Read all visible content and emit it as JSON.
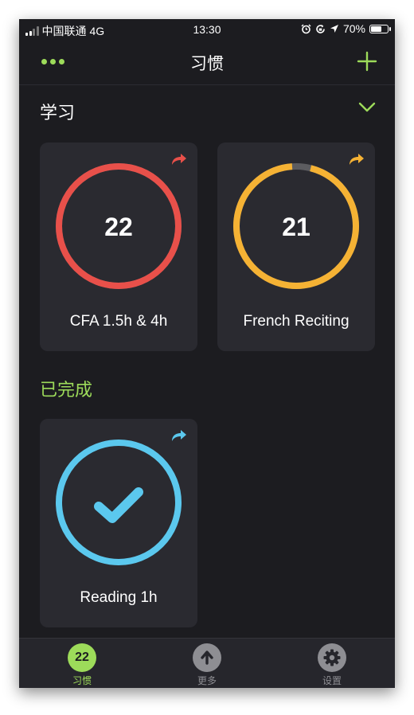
{
  "status_bar": {
    "carrier": "中国联通",
    "network": "4G",
    "time": "13:30",
    "battery": "70%",
    "battery_level": 0.7
  },
  "nav": {
    "title": "习惯",
    "more_icon": "ellipsis-icon",
    "add_icon": "plus-icon"
  },
  "sections": {
    "learning_title": "学习",
    "completed_title": "已完成"
  },
  "habits": [
    {
      "count": "22",
      "label": "CFA 1.5h & 4h",
      "color": "#e8504a",
      "progress": 1.0
    },
    {
      "count": "21",
      "label": "French Reciting",
      "color": "#f5b234",
      "progress": 0.95
    }
  ],
  "completed": [
    {
      "label": "Reading 1h",
      "color": "#5bc8ee",
      "state": "checked"
    }
  ],
  "tabs": [
    {
      "label": "习惯",
      "badge": "22",
      "active": true
    },
    {
      "label": "更多",
      "icon": "arrow-up-icon"
    },
    {
      "label": "设置",
      "icon": "gear-icon"
    }
  ],
  "colors": {
    "accent": "#9ddb5a",
    "background": "#1c1c20",
    "card": "#2a2a30",
    "inactive_tab": "#8e8e93"
  }
}
